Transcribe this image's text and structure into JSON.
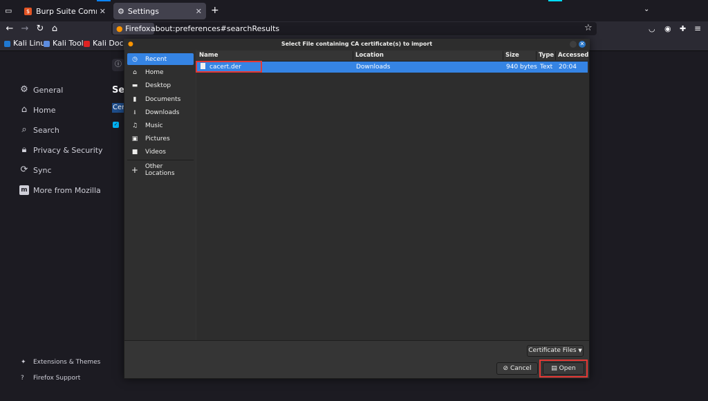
{
  "browser": {
    "tabs": [
      {
        "title": "Burp Suite Community E",
        "active": false
      },
      {
        "title": "Settings",
        "active": true
      }
    ],
    "new_tab": "+",
    "identity_label": "Firefox",
    "url": "about:preferences#searchResults",
    "bookmarks": [
      "Kali Linux",
      "Kali Tools",
      "Kali Docs"
    ]
  },
  "settings": {
    "heading_partial": "Sea",
    "result_partial": "Cer",
    "sidebar": [
      {
        "label": "General",
        "icon": "gear-icon"
      },
      {
        "label": "Home",
        "icon": "home-icon"
      },
      {
        "label": "Search",
        "icon": "search-icon"
      },
      {
        "label": "Privacy & Security",
        "icon": "lock-icon"
      },
      {
        "label": "Sync",
        "icon": "sync-icon"
      },
      {
        "label": "More from Mozilla",
        "icon": "mozilla-icon"
      }
    ],
    "footer": [
      {
        "label": "Extensions & Themes",
        "icon": "puzzle-icon"
      },
      {
        "label": "Firefox Support",
        "icon": "help-icon"
      }
    ]
  },
  "dialog": {
    "title": "Select File containing CA certificate(s) to import",
    "places": [
      {
        "label": "Recent",
        "icon": "clock-icon",
        "selected": true
      },
      {
        "label": "Home",
        "icon": "home-icon",
        "selected": false
      },
      {
        "label": "Desktop",
        "icon": "desktop-icon",
        "selected": false
      },
      {
        "label": "Documents",
        "icon": "documents-icon",
        "selected": false
      },
      {
        "label": "Downloads",
        "icon": "downloads-icon",
        "selected": false
      },
      {
        "label": "Music",
        "icon": "music-icon",
        "selected": false
      },
      {
        "label": "Pictures",
        "icon": "pictures-icon",
        "selected": false
      },
      {
        "label": "Videos",
        "icon": "videos-icon",
        "selected": false
      }
    ],
    "other_locations": "Other Locations",
    "columns": {
      "name": "Name",
      "location": "Location",
      "size": "Size",
      "type": "Type",
      "accessed": "Accessed"
    },
    "files": [
      {
        "name": "cacert.der",
        "location": "Downloads",
        "size": "940 bytes",
        "type": "Text",
        "accessed": "20:04"
      }
    ],
    "filter": "Certificate Files",
    "cancel": "Cancel",
    "open": "Open"
  },
  "colors": {
    "accent": "#3584e4",
    "highlight": "#e53935",
    "firefox_blue": "#0a84ff"
  }
}
